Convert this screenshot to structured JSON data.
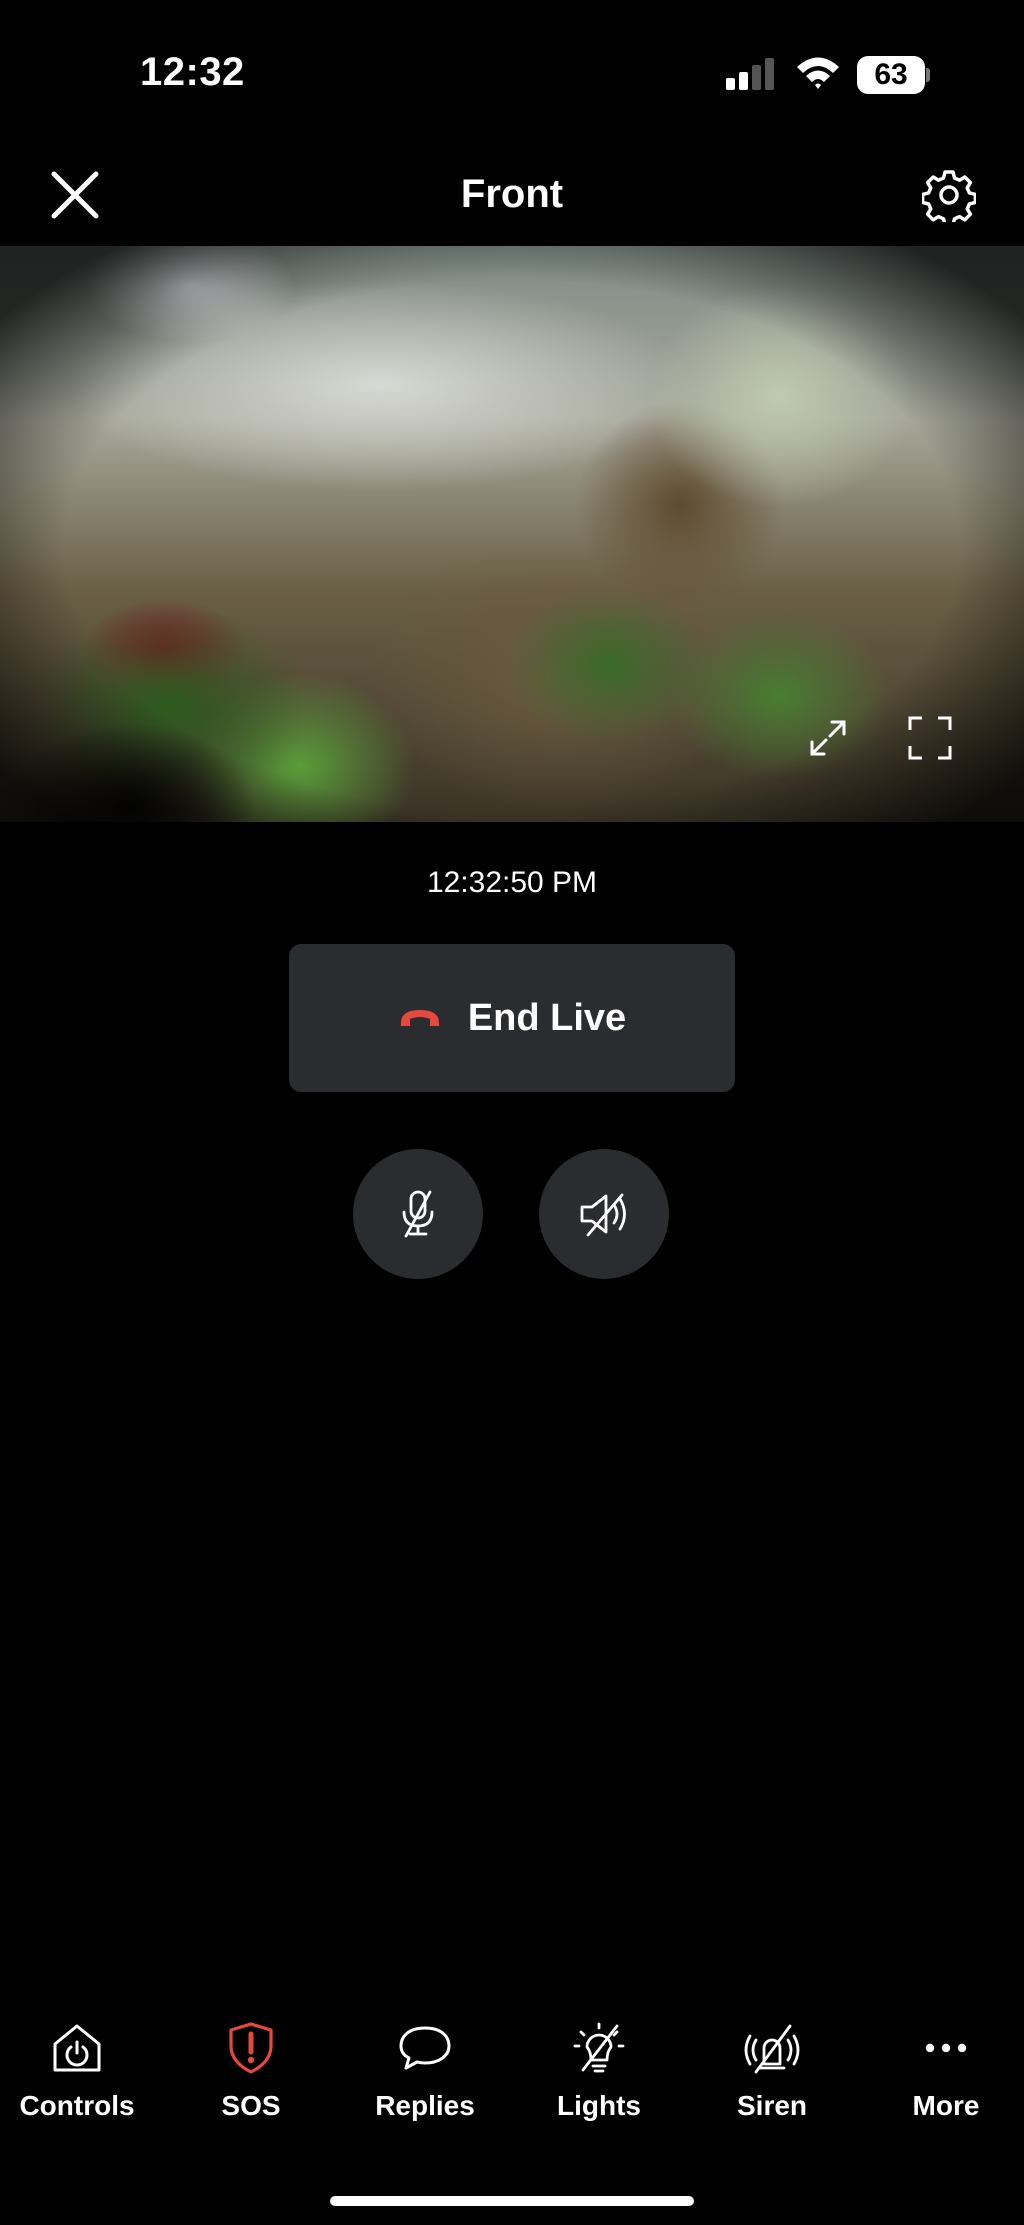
{
  "status_bar": {
    "time": "12:32",
    "battery": "63"
  },
  "header": {
    "title": "Front",
    "close_icon": "close-icon",
    "settings_icon": "gear-icon"
  },
  "live": {
    "timestamp": "12:32:50 PM",
    "end_label": "End Live",
    "end_icon": "hang-up-icon",
    "end_icon_color": "#e5483c"
  },
  "audio": {
    "mic_icon": "microphone-muted-icon",
    "speaker_icon": "speaker-muted-icon"
  },
  "bottom_nav": [
    {
      "label": "Controls",
      "icon": "power-icon"
    },
    {
      "label": "SOS",
      "icon": "shield-alert-icon",
      "color": "#e5483c"
    },
    {
      "label": "Replies",
      "icon": "chat-bubble-icon"
    },
    {
      "label": "Lights",
      "icon": "light-off-icon"
    },
    {
      "label": "Siren",
      "icon": "siren-off-icon"
    },
    {
      "label": "More",
      "icon": "more-dots-icon"
    }
  ]
}
